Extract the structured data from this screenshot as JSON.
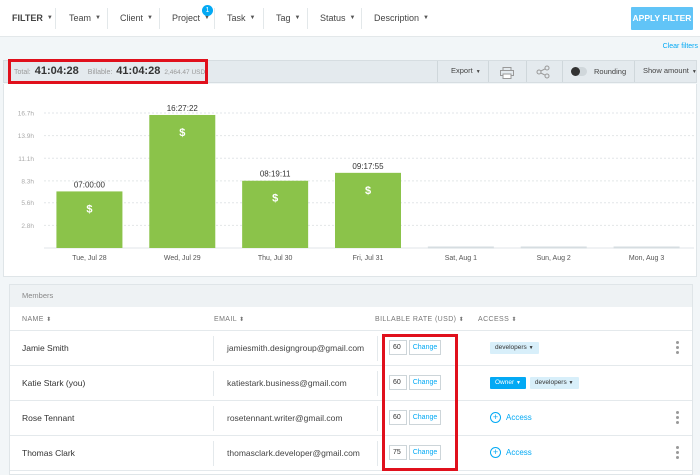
{
  "filter_bar": {
    "filter_label": "FILTER",
    "items": [
      {
        "label": "Team"
      },
      {
        "label": "Client"
      },
      {
        "label": "Project",
        "badge": "1"
      },
      {
        "label": "Task"
      },
      {
        "label": "Tag"
      },
      {
        "label": "Status"
      },
      {
        "label": "Description"
      }
    ],
    "apply_label": "APPLY FILTER",
    "clear_label": "Clear filters"
  },
  "totals": {
    "total_label": "Total:",
    "total_value": "41:04:28",
    "billable_label": "Billable:",
    "billable_value": "41:04:28",
    "amount": "2,464.47 USD",
    "export_label": "Export",
    "rounding_label": "Rounding",
    "show_amount_label": "Show amount"
  },
  "chart_data": {
    "type": "bar",
    "categories": [
      "Tue, Jul 28",
      "Wed, Jul 29",
      "Thu, Jul 30",
      "Fri, Jul 31",
      "Sat, Aug 1",
      "Sun, Aug 2",
      "Mon, Aug 3"
    ],
    "values": [
      7.0,
      16.4561,
      8.3197,
      9.2986,
      0,
      0,
      0
    ],
    "bar_labels": [
      "07:00:00",
      "16:27:22",
      "08:19:11",
      "09:17:55",
      "",
      "",
      ""
    ],
    "ytick_labels": [
      "16.7h",
      "13.9h",
      "11.1h",
      "8.3h",
      "5.6h",
      "2.8h"
    ],
    "ytick_values": [
      16.7,
      13.9,
      11.1,
      8.3,
      5.6,
      2.8
    ],
    "ylim": [
      0,
      16.7
    ],
    "bar_color": "#8bc34a",
    "billable_symbol": "$",
    "grid": true
  },
  "members": {
    "section_title": "Members",
    "columns": {
      "name": "NAME",
      "email": "EMAIL",
      "rate": "BILLABLE RATE (USD)",
      "access": "ACCESS"
    },
    "change_label": "Change",
    "access_label": "Access",
    "rows": [
      {
        "name": "Jamie Smith",
        "email": "jamiesmith.designgroup@gmail.com",
        "rate": "60",
        "owner": "",
        "group": "developers"
      },
      {
        "name": "Katie Stark (you)",
        "email": "katiestark.business@gmail.com",
        "rate": "60",
        "owner": "Owner",
        "group": "developers"
      },
      {
        "name": "Rose Tennant",
        "email": "rosetennant.writer@gmail.com",
        "rate": "60",
        "owner": "",
        "group": ""
      },
      {
        "name": "Thomas Clark",
        "email": "thomasclark.developer@gmail.com",
        "rate": "75",
        "owner": "",
        "group": ""
      }
    ]
  },
  "colors": {
    "accent": "#03a9f4",
    "apply_button": "#61c4f7",
    "highlight_box": "#e0101c"
  }
}
